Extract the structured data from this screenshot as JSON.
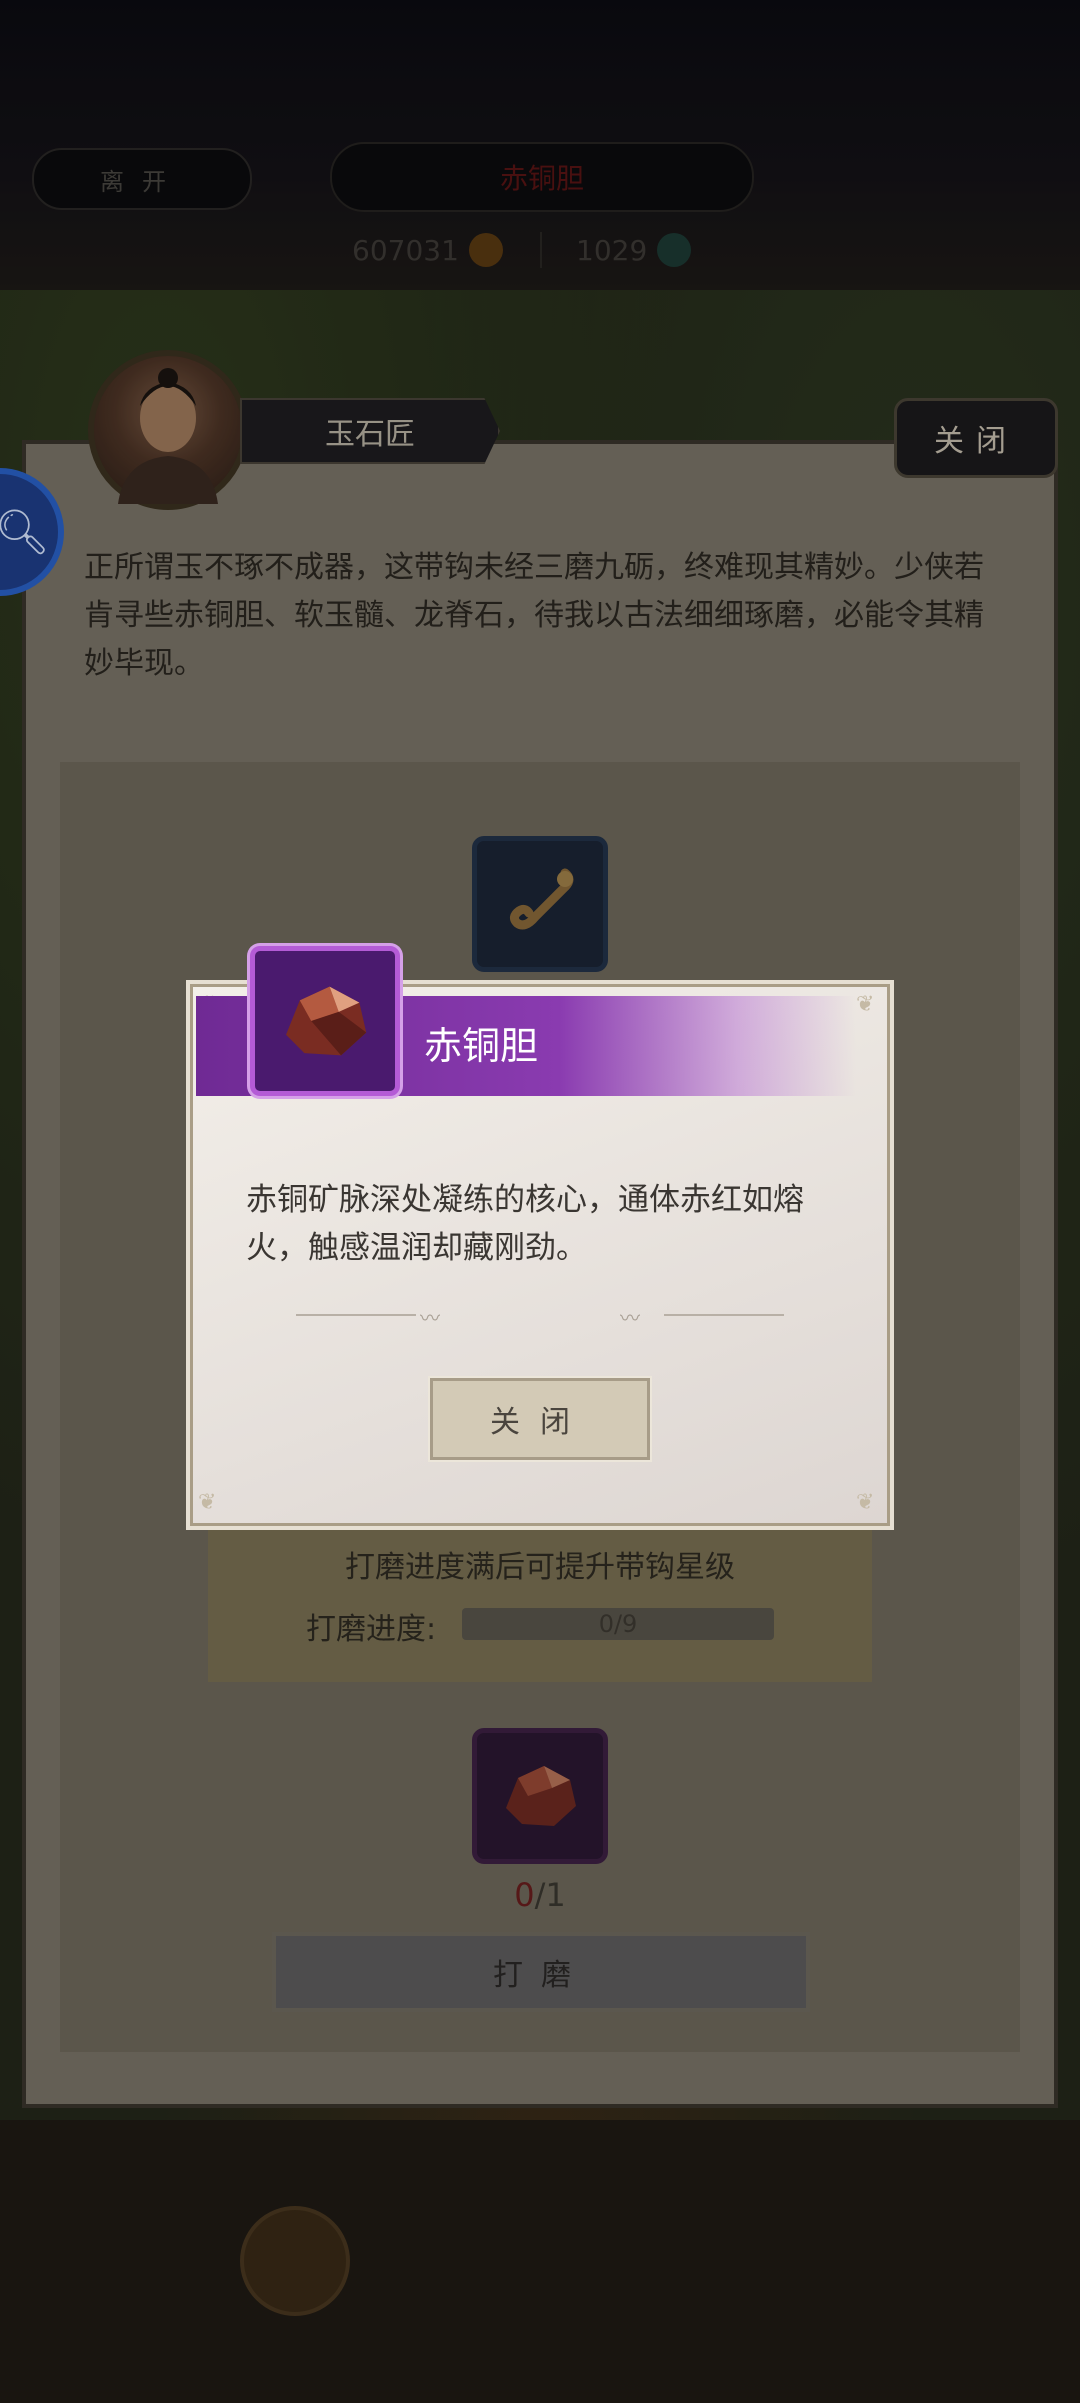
{
  "hud": {
    "leave_label": "离开",
    "title": "赤铜胆",
    "currency_1": "607031",
    "currency_2": "1029"
  },
  "npc": {
    "name": "玉石匠",
    "close_label": "关闭",
    "dialogue": "正所谓玉不琢不成器，这带钩未经三磨九砺，终难现其精妙。少侠若肯寻些赤铜胆、软玉髓、龙脊石，待我以古法细细琢磨，必能令其精妙毕现。"
  },
  "polish": {
    "caption": "打磨进度满后可提升带钩星级",
    "progress_label": "打磨进度:",
    "progress_text": "0/9",
    "progress_value": 0,
    "progress_max": 9,
    "material_have": "0",
    "material_need": "/1",
    "button_label": "打磨"
  },
  "popup": {
    "title": "赤铜胆",
    "description": "赤铜矿脉深处凝练的核心，通体赤红如熔火，触感温润却藏刚劲。",
    "close_label": "关闭"
  },
  "colors": {
    "rarity_purple": "#8a3bb0",
    "item_slot_blue": "#23324a"
  },
  "icons": {
    "item": "belt-hook-icon",
    "material": "red-copper-ore-icon",
    "search": "search-icon",
    "coin": "coin-icon",
    "gem": "gem-icon"
  }
}
